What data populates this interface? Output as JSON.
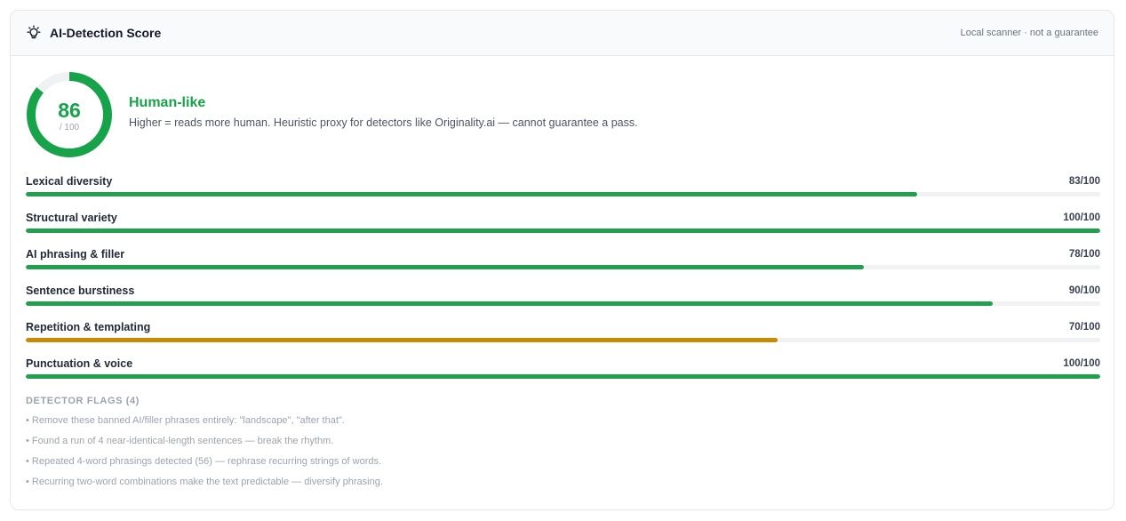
{
  "header": {
    "title": "AI-Detection Score",
    "note": "Local scanner · not a guarantee",
    "icon": "lightbulb-icon"
  },
  "summary": {
    "score": "86",
    "score_value": 86,
    "max": "/ 100",
    "verdict": "Human-like",
    "description": "Higher = reads more human. Heuristic proxy for detectors like Originality.ai — cannot guarantee a pass."
  },
  "colors": {
    "good": "#16a34a",
    "bar_good": "#22a04f",
    "bar_warn": "#ca8a04",
    "track": "#f0f1f2"
  },
  "metrics": [
    {
      "label": "Lexical diversity",
      "value": "83/100",
      "score": 83,
      "status": "good"
    },
    {
      "label": "Structural variety",
      "value": "100/100",
      "score": 100,
      "status": "good"
    },
    {
      "label": "AI phrasing & filler",
      "value": "78/100",
      "score": 78,
      "status": "good"
    },
    {
      "label": "Sentence burstiness",
      "value": "90/100",
      "score": 90,
      "status": "good"
    },
    {
      "label": "Repetition & templating",
      "value": "70/100",
      "score": 70,
      "status": "warn"
    },
    {
      "label": "Punctuation & voice",
      "value": "100/100",
      "score": 100,
      "status": "good"
    }
  ],
  "flags": {
    "title": "DETECTOR FLAGS (4)",
    "items": [
      "Remove these banned AI/filler phrases entirely: \"landscape\", \"after that\".",
      "Found a run of 4 near-identical-length sentences — break the rhythm.",
      "Repeated 4-word phrasings detected (56) — rephrase recurring strings of words.",
      "Recurring two-word combinations make the text predictable — diversify phrasing."
    ]
  }
}
